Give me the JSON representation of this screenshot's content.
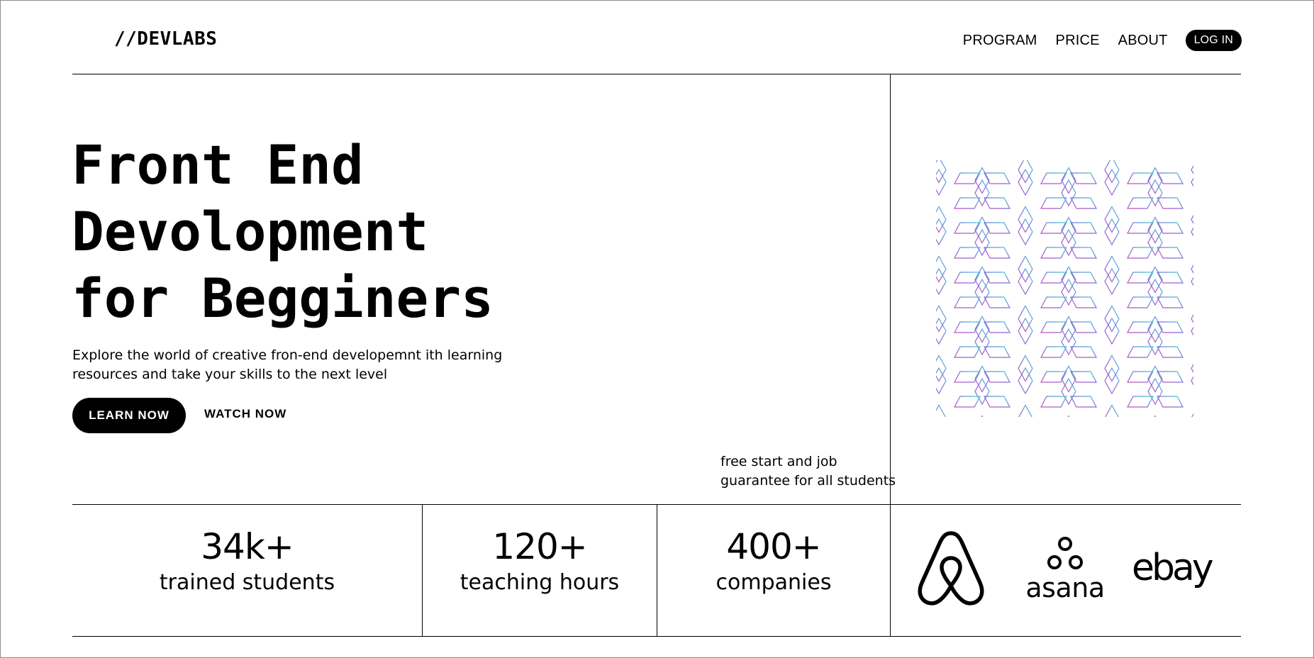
{
  "header": {
    "logo": "//DEVLABS",
    "nav": [
      {
        "label": "PROGRAM"
      },
      {
        "label": "PRICE"
      },
      {
        "label": "ABOUT"
      }
    ],
    "login_label": "LOG IN"
  },
  "hero": {
    "headline_lines": [
      "Front End",
      "Devolopment",
      "for Begginers"
    ],
    "description_lines": [
      "Explore the world of creative fron-end developemnt ith learning",
      "resources and take your skills to the next level"
    ],
    "learn_label": "LEARN NOW",
    "watch_label": "WATCH NOW",
    "guarantee_lines": [
      "free start and job",
      "guarantee for all students"
    ]
  },
  "stats": [
    {
      "value": "34k+",
      "label": "trained students"
    },
    {
      "value": "120+",
      "label": "teaching hours"
    },
    {
      "value": "400+",
      "label": "companies"
    }
  ],
  "partners": {
    "logos": [
      {
        "icon": "airbnb-logo-icon"
      },
      {
        "icon": "asana-logo-icon",
        "wordmark": "asana"
      },
      {
        "icon": "ebay-logo-icon",
        "wordmark": "ebay"
      }
    ]
  },
  "colors": {
    "pattern_start": "#c24fc0",
    "pattern_mid": "#7c72d8",
    "pattern_end": "#3fd0d6",
    "accent": "#000000"
  }
}
